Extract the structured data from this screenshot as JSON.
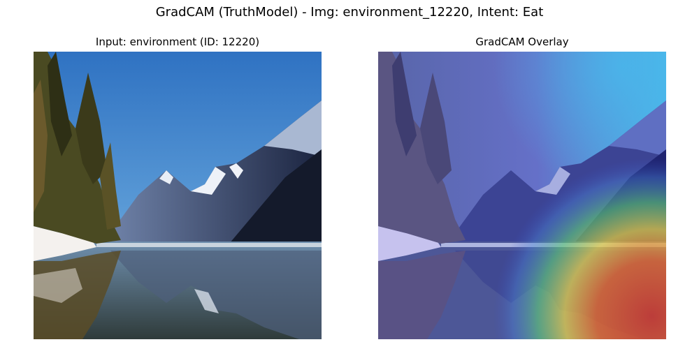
{
  "figure": {
    "suptitle": "GradCAM (TruthModel) - Img: environment_12220, Intent: Eat"
  },
  "panels": [
    {
      "title": "Input: environment (ID: 12220)",
      "content": "photo of an alpine lake with conifer trees on the left, snowy mountains and their reflection in the water"
    },
    {
      "title": "GradCAM Overlay",
      "content": "same photo with a jet-colormap heatmap overlay, strongest activation in the lower right over the water"
    }
  ]
}
